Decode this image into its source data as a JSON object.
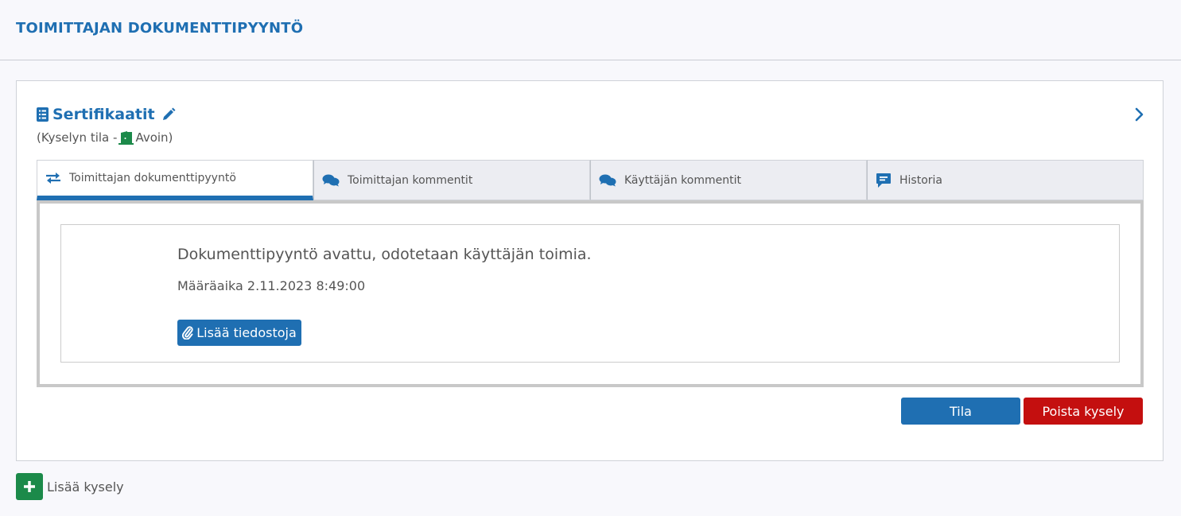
{
  "header": {
    "title": "TOIMITTAJAN DOKUMENTTIPYYNTÖ"
  },
  "card": {
    "title": "Sertifikaatit",
    "status_prefix": "(Kyselyn tila -",
    "status_value": "Avoin)",
    "status_icon": "door-open-icon",
    "status_color": "#1c8a4a"
  },
  "tabs": [
    {
      "label": "Toimittajan dokumenttipyyntö",
      "icon": "exchange-arrows-icon",
      "active": true
    },
    {
      "label": "Toimittajan kommentit",
      "icon": "comments-icon",
      "active": false
    },
    {
      "label": "Käyttäjän kommentit",
      "icon": "comments-icon",
      "active": false
    },
    {
      "label": "Historia",
      "icon": "message-icon",
      "active": false
    }
  ],
  "panel": {
    "message": "Dokumenttipyyntö avattu, odotetaan käyttäjän toimia.",
    "deadline": "Määräaika 2.11.2023 8:49:00",
    "add_files_label": "Lisää tiedostoja"
  },
  "actions": {
    "status_label": "Tila",
    "delete_label": "Poista kysely"
  },
  "footer": {
    "add_query_label": "Lisää kysely"
  },
  "colors": {
    "primary": "#1f6fb2",
    "danger": "#c40f0f",
    "success": "#1c8a4a"
  }
}
